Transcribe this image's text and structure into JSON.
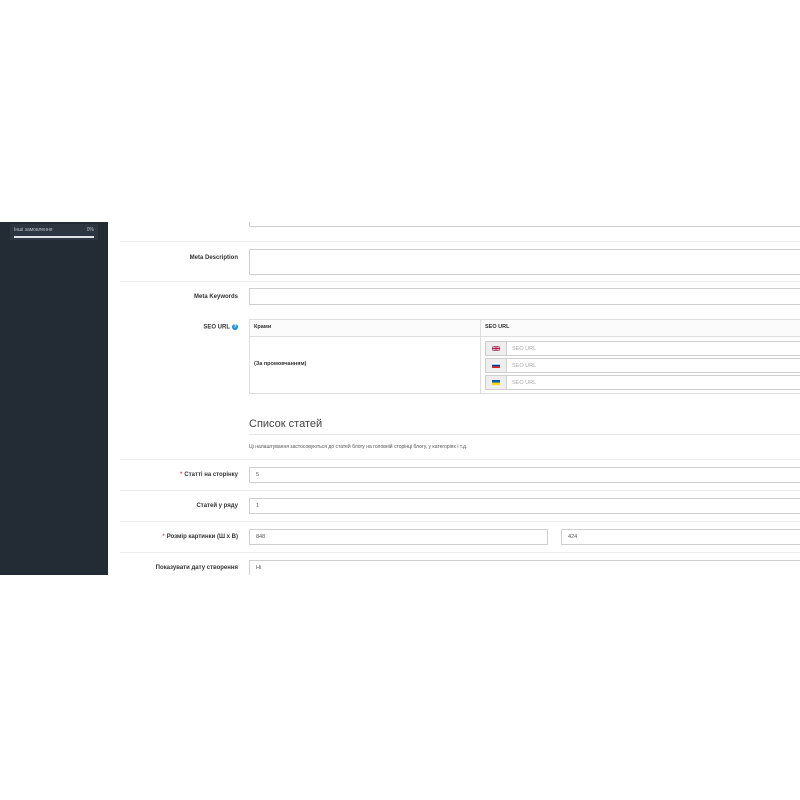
{
  "sidebar": {
    "stat": {
      "label": "Інші замовлення",
      "value": "0%",
      "progress_fraction": 1.0
    }
  },
  "form": {
    "meta_description_label": "Meta Description",
    "meta_keywords_label": "Meta Keywords",
    "seo_url_label": "SEO URL",
    "seo_table": {
      "col_stores": "Крами",
      "col_seo_url": "SEO URL",
      "store_name": "(За промовчанням)",
      "rows": [
        {
          "flag_icon": "uk-flag-icon",
          "placeholder": "SEO URL"
        },
        {
          "flag_icon": "ru-flag-icon",
          "placeholder": "SEO URL"
        },
        {
          "flag_icon": "ua-flag-icon",
          "placeholder": "SEO URL"
        }
      ]
    },
    "section_title": "Список статей",
    "section_note": "Ці налаштування застосовуються до статей блогу на головній сторінці блогу, у категоріях і т.д.",
    "articles_per_page": {
      "label": "Статті на сторінку",
      "value": "5"
    },
    "articles_per_row": {
      "label": "Статей у ряду",
      "value": "1"
    },
    "image_size": {
      "label": "Розмір картинки (Ш x В)",
      "width": "848",
      "height": "424"
    },
    "show_date": {
      "label": "Показувати дату створення",
      "value": "Ні"
    }
  },
  "colors": {
    "sidebar_bg": "#232b35",
    "required": "#e3503e",
    "help": "#1e91cf"
  }
}
